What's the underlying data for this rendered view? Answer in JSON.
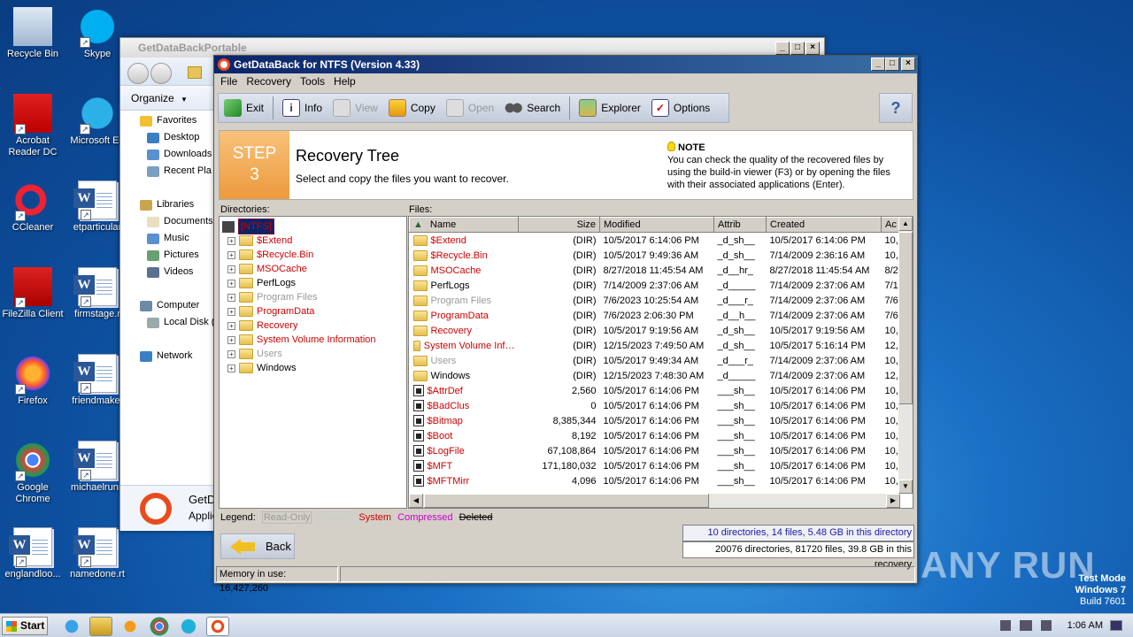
{
  "desktop": {
    "icons": [
      {
        "label": "Recycle Bin",
        "icon": "recycle-bin-icon"
      },
      {
        "label": "Skype",
        "icon": "skype-icon"
      },
      {
        "label": "Acrobat Reader DC",
        "icon": "acrobat-icon"
      },
      {
        "label": "Microsoft Ed",
        "icon": "edge-icon"
      },
      {
        "label": "CCleaner",
        "icon": "ccleaner-icon"
      },
      {
        "label": "etparticular",
        "icon": "word-doc-icon"
      },
      {
        "label": "FileZilla Client",
        "icon": "filezilla-icon"
      },
      {
        "label": "firmstage.r",
        "icon": "word-doc-icon"
      },
      {
        "label": "Firefox",
        "icon": "firefox-icon"
      },
      {
        "label": "friendmake.",
        "icon": "word-doc-icon"
      },
      {
        "label": "Google Chrome",
        "icon": "chrome-icon"
      },
      {
        "label": "michaelrunn",
        "icon": "word-doc-icon"
      },
      {
        "label": "englandloo...",
        "icon": "word-doc-icon"
      },
      {
        "label": "namedone.rt",
        "icon": "word-doc-icon"
      }
    ]
  },
  "explorer": {
    "title": "GetDataBackPortable",
    "organize": "Organize",
    "nav": [
      {
        "label": "Favorites",
        "bold": true
      },
      {
        "label": "Desktop"
      },
      {
        "label": "Downloads"
      },
      {
        "label": "Recent Pla"
      },
      {
        "label": ""
      },
      {
        "label": "Libraries"
      },
      {
        "label": "Documents"
      },
      {
        "label": "Music"
      },
      {
        "label": "Pictures"
      },
      {
        "label": "Videos"
      },
      {
        "label": ""
      },
      {
        "label": "Computer"
      },
      {
        "label": "Local Disk ("
      },
      {
        "label": ""
      },
      {
        "label": "Network"
      }
    ],
    "bottom_title": "GetD",
    "bottom_sub": "Applic"
  },
  "app": {
    "title": "GetDataBack for NTFS (Version 4.33)",
    "menu": [
      "File",
      "Recovery",
      "Tools",
      "Help"
    ],
    "toolbar": {
      "exit": "Exit",
      "info": "Info",
      "view": "View",
      "copy": "Copy",
      "open": "Open",
      "search": "Search",
      "explorer": "Explorer",
      "options": "Options"
    },
    "step": {
      "line1": "STEP",
      "line2": "3",
      "title": "Recovery Tree",
      "subtitle": "Select and copy the files you want to recover."
    },
    "note": {
      "heading": "NOTE",
      "text": "You can check the quality of the recovered files by using the build-in viewer (F3) or by opening the files with their associated applications (Enter)."
    },
    "directories_label": "Directories:",
    "files_label": "Files:",
    "tree_root": "[NTFS]",
    "tree": [
      {
        "name": "$Extend",
        "color": "red"
      },
      {
        "name": "$Recycle.Bin",
        "color": "red"
      },
      {
        "name": "MSOCache",
        "color": "red"
      },
      {
        "name": "PerfLogs",
        "color": "black"
      },
      {
        "name": "Program Files",
        "color": "gray"
      },
      {
        "name": "ProgramData",
        "color": "red"
      },
      {
        "name": "Recovery",
        "color": "red"
      },
      {
        "name": "System Volume Information",
        "color": "red"
      },
      {
        "name": "Users",
        "color": "gray"
      },
      {
        "name": "Windows",
        "color": "black"
      }
    ],
    "columns": [
      "Name",
      "Size",
      "Modified",
      "Attrib",
      "Created",
      "Ac"
    ],
    "files": [
      {
        "name": "$Extend",
        "size": "(DIR)",
        "modified": "10/5/2017 6:14:06 PM",
        "attrib": "_d_sh__",
        "created": "10/5/2017 6:14:06 PM",
        "ac": "10,",
        "color": "red",
        "dir": true
      },
      {
        "name": "$Recycle.Bin",
        "size": "(DIR)",
        "modified": "10/5/2017 9:49:36 AM",
        "attrib": "_d_sh__",
        "created": "7/14/2009 2:36:16 AM",
        "ac": "10,",
        "color": "red",
        "dir": true
      },
      {
        "name": "MSOCache",
        "size": "(DIR)",
        "modified": "8/27/2018 11:45:54 AM",
        "attrib": "_d__hr_",
        "created": "8/27/2018 11:45:54 AM",
        "ac": "8/2",
        "color": "red",
        "dir": true
      },
      {
        "name": "PerfLogs",
        "size": "(DIR)",
        "modified": "7/14/2009 2:37:06 AM",
        "attrib": "_d_____",
        "created": "7/14/2009 2:37:06 AM",
        "ac": "7/1",
        "color": "black",
        "dir": true
      },
      {
        "name": "Program Files",
        "size": "(DIR)",
        "modified": "7/6/2023 10:25:54 AM",
        "attrib": "_d___r_",
        "created": "7/14/2009 2:37:06 AM",
        "ac": "7/6",
        "color": "gray",
        "dir": true
      },
      {
        "name": "ProgramData",
        "size": "(DIR)",
        "modified": "7/6/2023 2:06:30 PM",
        "attrib": "_d__h__",
        "created": "7/14/2009 2:37:06 AM",
        "ac": "7/6",
        "color": "red",
        "dir": true
      },
      {
        "name": "Recovery",
        "size": "(DIR)",
        "modified": "10/5/2017 9:19:56 AM",
        "attrib": "_d_sh__",
        "created": "10/5/2017 9:19:56 AM",
        "ac": "10,",
        "color": "red",
        "dir": true
      },
      {
        "name": "System Volume Inf…",
        "size": "(DIR)",
        "modified": "12/15/2023 7:49:50 AM",
        "attrib": "_d_sh__",
        "created": "10/5/2017 5:16:14 PM",
        "ac": "12,",
        "color": "red",
        "dir": true
      },
      {
        "name": "Users",
        "size": "(DIR)",
        "modified": "10/5/2017 9:49:34 AM",
        "attrib": "_d___r_",
        "created": "7/14/2009 2:37:06 AM",
        "ac": "10,",
        "color": "gray",
        "dir": true
      },
      {
        "name": "Windows",
        "size": "(DIR)",
        "modified": "12/15/2023 7:48:30 AM",
        "attrib": "_d_____",
        "created": "7/14/2009 2:37:06 AM",
        "ac": "12,",
        "color": "black",
        "dir": true
      },
      {
        "name": "$AttrDef",
        "size": "2,560",
        "modified": "10/5/2017 6:14:06 PM",
        "attrib": "___sh__",
        "created": "10/5/2017 6:14:06 PM",
        "ac": "10,",
        "color": "red",
        "dir": false
      },
      {
        "name": "$BadClus",
        "size": "0",
        "modified": "10/5/2017 6:14:06 PM",
        "attrib": "___sh__",
        "created": "10/5/2017 6:14:06 PM",
        "ac": "10,",
        "color": "red",
        "dir": false
      },
      {
        "name": "$Bitmap",
        "size": "8,385,344",
        "modified": "10/5/2017 6:14:06 PM",
        "attrib": "___sh__",
        "created": "10/5/2017 6:14:06 PM",
        "ac": "10,",
        "color": "red",
        "dir": false
      },
      {
        "name": "$Boot",
        "size": "8,192",
        "modified": "10/5/2017 6:14:06 PM",
        "attrib": "___sh__",
        "created": "10/5/2017 6:14:06 PM",
        "ac": "10,",
        "color": "red",
        "dir": false
      },
      {
        "name": "$LogFile",
        "size": "67,108,864",
        "modified": "10/5/2017 6:14:06 PM",
        "attrib": "___sh__",
        "created": "10/5/2017 6:14:06 PM",
        "ac": "10,",
        "color": "red",
        "dir": false
      },
      {
        "name": "$MFT",
        "size": "171,180,032",
        "modified": "10/5/2017 6:14:06 PM",
        "attrib": "___sh__",
        "created": "10/5/2017 6:14:06 PM",
        "ac": "10,",
        "color": "red",
        "dir": false
      },
      {
        "name": "$MFTMirr",
        "size": "4,096",
        "modified": "10/5/2017 6:14:06 PM",
        "attrib": "___sh__",
        "created": "10/5/2017 6:14:06 PM",
        "ac": "10,",
        "color": "red",
        "dir": false
      }
    ],
    "legend": {
      "label": "Legend:",
      "read_only": "Read-Only",
      "hidden": "Hidden",
      "system": "System",
      "compressed": "Compressed",
      "deleted": "Deleted"
    },
    "status_dir": "10 directories, 14 files, 5.48 GB in this directory",
    "status_recovery": "20076 directories, 81720 files, 39.8 GB in this recovery",
    "back": "Back",
    "memory": "Memory in use: 16,427,260"
  },
  "taskbar": {
    "start": "Start",
    "clock": "1:06 AM"
  },
  "watermark": {
    "line1": "Test Mode",
    "line2": "Windows 7",
    "line3": "Build 7601",
    "brand": "ANY RUN"
  },
  "colors": {
    "red": "#d00000",
    "gray": "#999999",
    "magenta": "#cc00cc",
    "link_blue": "#1a1aa6"
  }
}
